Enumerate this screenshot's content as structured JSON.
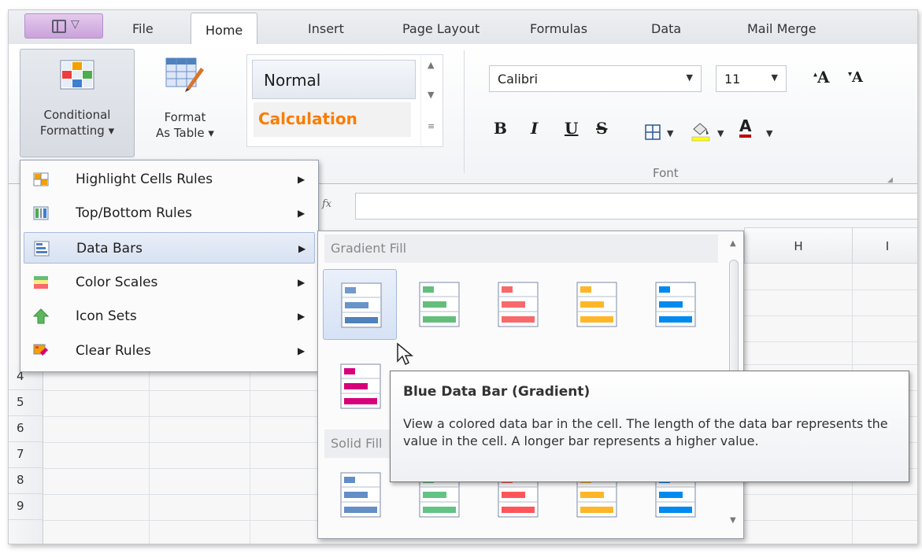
{
  "tabs": [
    "File",
    "Home",
    "Insert",
    "Page Layout",
    "Formulas",
    "Data",
    "Mail Merge"
  ],
  "active_tab": "Home",
  "ribbon": {
    "conditional_formatting": {
      "line1": "Conditional",
      "line2": "Formatting ▾"
    },
    "format_as_table": {
      "line1": "Format",
      "line2": "As Table ▾"
    },
    "styles": {
      "normal": "Normal",
      "calculation": "Calculation"
    },
    "font": {
      "family": "Calibri",
      "size": "11",
      "grow": "A",
      "shrink": "A",
      "bold": "B",
      "italic": "I",
      "underline": "U",
      "strike": "S",
      "font_color": "A",
      "group_label": "Font"
    }
  },
  "formula_bar": {
    "fx": "fx",
    "value": ""
  },
  "columns": [
    "H",
    "I"
  ],
  "rows": [
    "4",
    "5",
    "6",
    "7",
    "8",
    "9"
  ],
  "menu": {
    "items": [
      {
        "label": "Highlight Cells Rules",
        "icon": "highlight-cells-icon"
      },
      {
        "label": "Top/Bottom Rules",
        "icon": "top-bottom-icon"
      },
      {
        "label": "Data Bars",
        "icon": "data-bars-icon",
        "hot": true
      },
      {
        "label": "Color Scales",
        "icon": "color-scales-icon"
      },
      {
        "label": "Icon Sets",
        "icon": "icon-sets-icon"
      },
      {
        "label": "Clear Rules",
        "icon": "clear-rules-icon"
      }
    ]
  },
  "submenu": {
    "gradient_header": "Gradient Fill",
    "solid_header": "Solid Fill",
    "colors": [
      "#4f81bd",
      "#63be7b",
      "#f8696b",
      "#ffb628",
      "#008aef",
      "#d6007b"
    ]
  },
  "tooltip": {
    "title": "Blue Data Bar (Gradient)",
    "body": "View a colored data bar in the cell. The length of the data bar represents the value in the cell. A longer bar represents a higher value."
  }
}
